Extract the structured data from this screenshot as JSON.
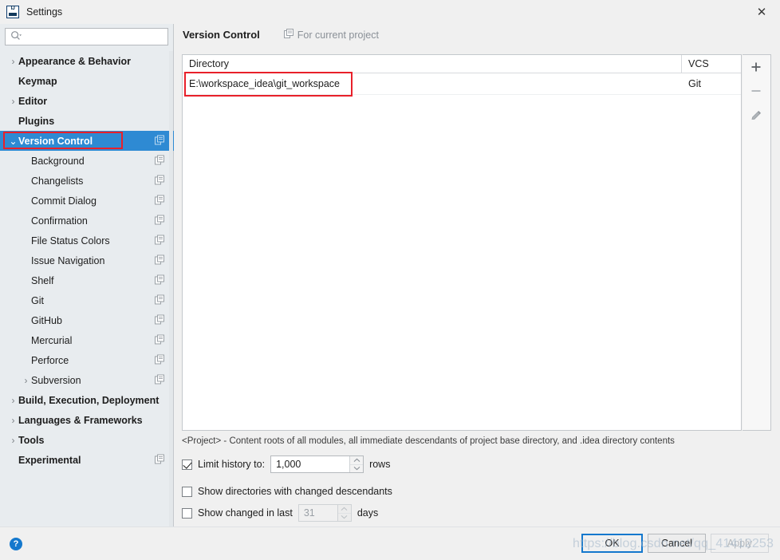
{
  "window": {
    "title": "Settings",
    "logo_icon": "intellij-idea-logo",
    "close_icon": "close-icon",
    "close_label": "✕"
  },
  "search": {
    "icon": "search-icon",
    "value": "",
    "placeholder": ""
  },
  "sidebar": {
    "items": [
      {
        "label": "Appearance & Behavior",
        "level": 0,
        "bold": true,
        "expander": "›",
        "has_expander": true,
        "selected": false,
        "copy_icon": false
      },
      {
        "label": "Keymap",
        "level": 0,
        "bold": true,
        "expander": "",
        "has_expander": false,
        "selected": false,
        "copy_icon": false
      },
      {
        "label": "Editor",
        "level": 0,
        "bold": true,
        "expander": "›",
        "has_expander": true,
        "selected": false,
        "copy_icon": false
      },
      {
        "label": "Plugins",
        "level": 0,
        "bold": true,
        "expander": "",
        "has_expander": false,
        "selected": false,
        "copy_icon": false
      },
      {
        "label": "Version Control",
        "level": 0,
        "bold": true,
        "expander": "⌄",
        "has_expander": true,
        "selected": true,
        "copy_icon": true
      },
      {
        "label": "Background",
        "level": 1,
        "bold": false,
        "expander": "",
        "has_expander": false,
        "selected": false,
        "copy_icon": true
      },
      {
        "label": "Changelists",
        "level": 1,
        "bold": false,
        "expander": "",
        "has_expander": false,
        "selected": false,
        "copy_icon": true
      },
      {
        "label": "Commit Dialog",
        "level": 1,
        "bold": false,
        "expander": "",
        "has_expander": false,
        "selected": false,
        "copy_icon": true
      },
      {
        "label": "Confirmation",
        "level": 1,
        "bold": false,
        "expander": "",
        "has_expander": false,
        "selected": false,
        "copy_icon": true
      },
      {
        "label": "File Status Colors",
        "level": 1,
        "bold": false,
        "expander": "",
        "has_expander": false,
        "selected": false,
        "copy_icon": true
      },
      {
        "label": "Issue Navigation",
        "level": 1,
        "bold": false,
        "expander": "",
        "has_expander": false,
        "selected": false,
        "copy_icon": true
      },
      {
        "label": "Shelf",
        "level": 1,
        "bold": false,
        "expander": "",
        "has_expander": false,
        "selected": false,
        "copy_icon": true
      },
      {
        "label": "Git",
        "level": 1,
        "bold": false,
        "expander": "",
        "has_expander": false,
        "selected": false,
        "copy_icon": true
      },
      {
        "label": "GitHub",
        "level": 1,
        "bold": false,
        "expander": "",
        "has_expander": false,
        "selected": false,
        "copy_icon": true
      },
      {
        "label": "Mercurial",
        "level": 1,
        "bold": false,
        "expander": "",
        "has_expander": false,
        "selected": false,
        "copy_icon": true
      },
      {
        "label": "Perforce",
        "level": 1,
        "bold": false,
        "expander": "",
        "has_expander": false,
        "selected": false,
        "copy_icon": true
      },
      {
        "label": "Subversion",
        "level": 1,
        "bold": false,
        "expander": "›",
        "has_expander": true,
        "selected": false,
        "copy_icon": true
      },
      {
        "label": "Build, Execution, Deployment",
        "level": 0,
        "bold": true,
        "expander": "›",
        "has_expander": true,
        "selected": false,
        "copy_icon": false
      },
      {
        "label": "Languages & Frameworks",
        "level": 0,
        "bold": true,
        "expander": "›",
        "has_expander": true,
        "selected": false,
        "copy_icon": false
      },
      {
        "label": "Tools",
        "level": 0,
        "bold": true,
        "expander": "›",
        "has_expander": true,
        "selected": false,
        "copy_icon": false
      },
      {
        "label": "Experimental",
        "level": 0,
        "bold": true,
        "expander": "",
        "has_expander": false,
        "selected": false,
        "copy_icon": true
      }
    ]
  },
  "main": {
    "title": "Version Control",
    "scope_label": "For current project",
    "scope_icon": "copy-settings-icon",
    "table": {
      "columns": [
        "Directory",
        "VCS"
      ],
      "rows": [
        {
          "directory": "E:\\workspace_idea\\git_workspace",
          "vcs": "Git"
        }
      ]
    },
    "tools": {
      "add_label": "+",
      "remove_label": "−",
      "edit_icon": "pencil-icon"
    },
    "hint": "<Project> - Content roots of all modules, all immediate descendants of project base directory, and .idea directory contents",
    "options": {
      "limit_history": {
        "label": "Limit history to:",
        "checked": true,
        "value": "1,000",
        "suffix": "rows"
      },
      "show_changed_descendants": {
        "label": "Show directories with changed descendants",
        "checked": false
      },
      "show_changed_in_last": {
        "label": "Show changed in last",
        "checked": false,
        "value": "31",
        "suffix": "days"
      }
    }
  },
  "footer": {
    "help_icon": "help-icon",
    "help_label": "?",
    "ok_label": "OK",
    "cancel_label": "Cancel",
    "apply_label": "Apply"
  },
  "watermark": {
    "text": "https://blog.csdn.net/qq_41412253"
  },
  "colors": {
    "accent": "#2e8ad3",
    "annotation": "#e8202a",
    "ok_border": "#1478cd",
    "sidebar_bg": "#e8ecef"
  }
}
